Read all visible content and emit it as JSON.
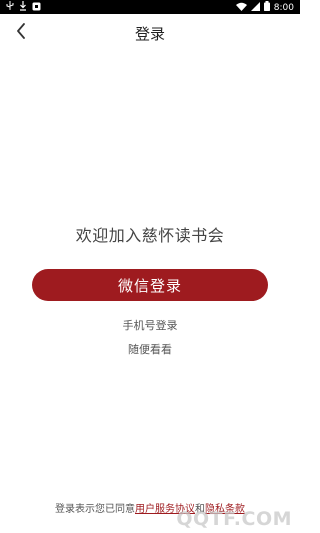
{
  "status_bar": {
    "left_icons": [
      "usb-icon",
      "download-icon",
      "notification-icon"
    ],
    "right_icons": [
      "wifi-icon",
      "signal-icon",
      "battery-icon"
    ],
    "time": "8:00"
  },
  "nav": {
    "back_icon": "chevron-left-icon",
    "title": "登录"
  },
  "main": {
    "welcome_text": "欢迎加入慈怀读书会",
    "wechat_login_label": "微信登录",
    "phone_login_label": "手机号登录",
    "guest_browse_label": "随便看看"
  },
  "agreement": {
    "prefix": "登录表示您已同意",
    "user_agreement": "用户服务协议",
    "conjunction": "和",
    "privacy_policy": "隐私条款"
  },
  "watermark": "QQTF.COM",
  "colors": {
    "accent": "#9e1b1f",
    "background": "#ffffff",
    "status_bar": "#000000"
  }
}
